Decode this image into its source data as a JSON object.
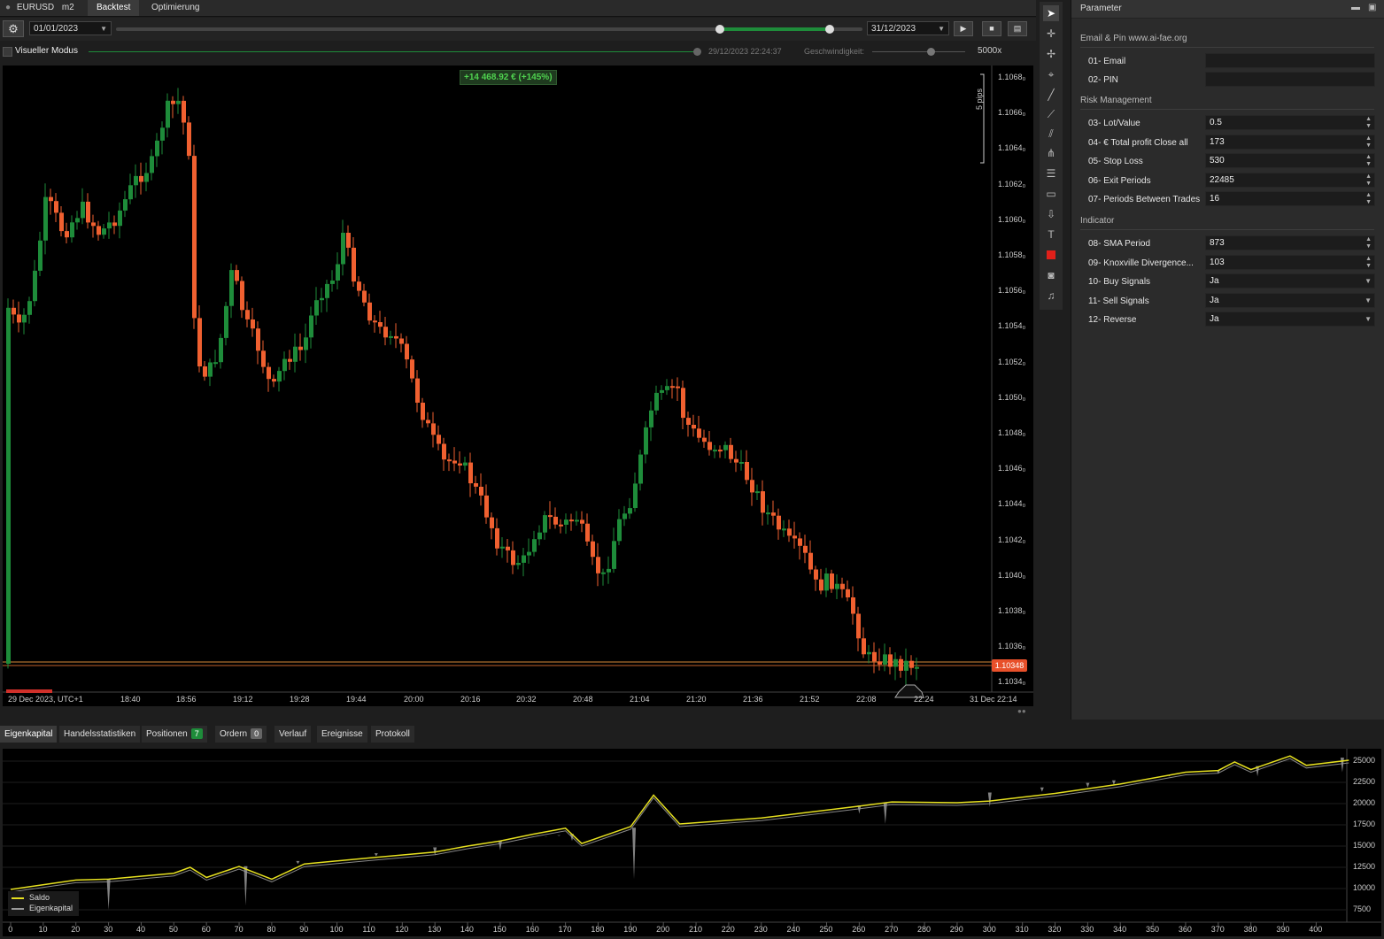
{
  "top_tabs": {
    "symbol": "EURUSD",
    "timeframe": "m2",
    "backtest": "Backtest",
    "optimization": "Optimierung"
  },
  "toolbar": {
    "start_date": "01/01/2023",
    "end_date": "31/12/2023",
    "progress_start": 0.0,
    "progress_handle_left": 0.6,
    "progress_handle_right": 0.95
  },
  "visual_mode": {
    "label": "Visueller Modus",
    "datetime": "29/12/2023 22:24:37",
    "speed_label": "Geschwindigkeit:",
    "speed": "5000x"
  },
  "chart": {
    "profit_badge": "+14 468.92 € (+145%)",
    "pips_label": "5 pips",
    "current_price": "1.10348",
    "price_ticks": [
      "1.1068₀",
      "1.1066₀",
      "1.1064₀",
      "1.1062₀",
      "1.1060₀",
      "1.1058₀",
      "1.1056₀",
      "1.1054₀",
      "1.1052₀",
      "1.1050₀",
      "1.1048₀",
      "1.1046₀",
      "1.1044₀",
      "1.1042₀",
      "1.1040₀",
      "1.1038₀",
      "1.1036₀",
      "1.1034₀"
    ],
    "time_ticks": [
      "29 Dec 2023, UTC+1",
      "18:40",
      "18:56",
      "19:12",
      "19:28",
      "19:44",
      "20:00",
      "20:16",
      "20:32",
      "20:48",
      "21:04",
      "21:20",
      "21:36",
      "21:52",
      "22:08",
      "22:24",
      "31 Dec 22:14"
    ],
    "colors": {
      "up": "#1e8c3a",
      "down": "#f06030"
    }
  },
  "parameters": {
    "title": "Parameter",
    "sections": [
      {
        "name": "Email & Pin www.ai-fae.org",
        "items": [
          {
            "label": "01- Email",
            "value": "",
            "kind": "text"
          },
          {
            "label": "02- PIN",
            "value": "",
            "kind": "text"
          }
        ]
      },
      {
        "name": "Risk Management",
        "items": [
          {
            "label": "03- Lot/Value",
            "value": "0.5",
            "kind": "spin"
          },
          {
            "label": "04- € Total profit Close all",
            "value": "173",
            "kind": "spin"
          },
          {
            "label": "05- Stop Loss",
            "value": "530",
            "kind": "spin"
          },
          {
            "label": "06- Exit Periods",
            "value": "22485",
            "kind": "spin"
          },
          {
            "label": "07- Periods Between Trades",
            "value": "16",
            "kind": "spin"
          }
        ]
      },
      {
        "name": "Indicator",
        "items": [
          {
            "label": "08- SMA Period",
            "value": "873",
            "kind": "spin"
          },
          {
            "label": "09- Knoxville Divergence...",
            "value": "103",
            "kind": "spin"
          },
          {
            "label": "10- Buy Signals",
            "value": "Ja",
            "kind": "select"
          },
          {
            "label": "11- Sell Signals",
            "value": "Ja",
            "kind": "select"
          },
          {
            "label": "12- Reverse",
            "value": "Ja",
            "kind": "select"
          }
        ]
      }
    ]
  },
  "bottom_tabs": [
    {
      "label": "Eigenkapital",
      "active": true
    },
    {
      "label": "Handelsstatistiken"
    },
    {
      "label": "Positionen",
      "badge": "7",
      "badge_color": "#1e8c3a"
    },
    {
      "label": "Ordern",
      "badge": "0",
      "badge_color": "#666"
    },
    {
      "label": "Verlauf"
    },
    {
      "label": "Ereignisse"
    },
    {
      "label": "Protokoll"
    }
  ],
  "equity": {
    "legend": [
      {
        "name": "Saldo",
        "color": "#e6e020"
      },
      {
        "name": "Eigenkapital",
        "color": "#999"
      }
    ],
    "y_ticks": [
      "25000",
      "22500",
      "20000",
      "17500",
      "15000",
      "12500",
      "10000",
      "7500"
    ],
    "x_ticks": [
      "0",
      "10",
      "20",
      "30",
      "40",
      "50",
      "60",
      "70",
      "80",
      "90",
      "100",
      "110",
      "120",
      "130",
      "140",
      "150",
      "160",
      "170",
      "180",
      "190",
      "200",
      "210",
      "220",
      "230",
      "240",
      "250",
      "260",
      "270",
      "280",
      "290",
      "300",
      "310",
      "320",
      "330",
      "340",
      "350",
      "360",
      "370",
      "380",
      "390",
      "400"
    ]
  }
}
